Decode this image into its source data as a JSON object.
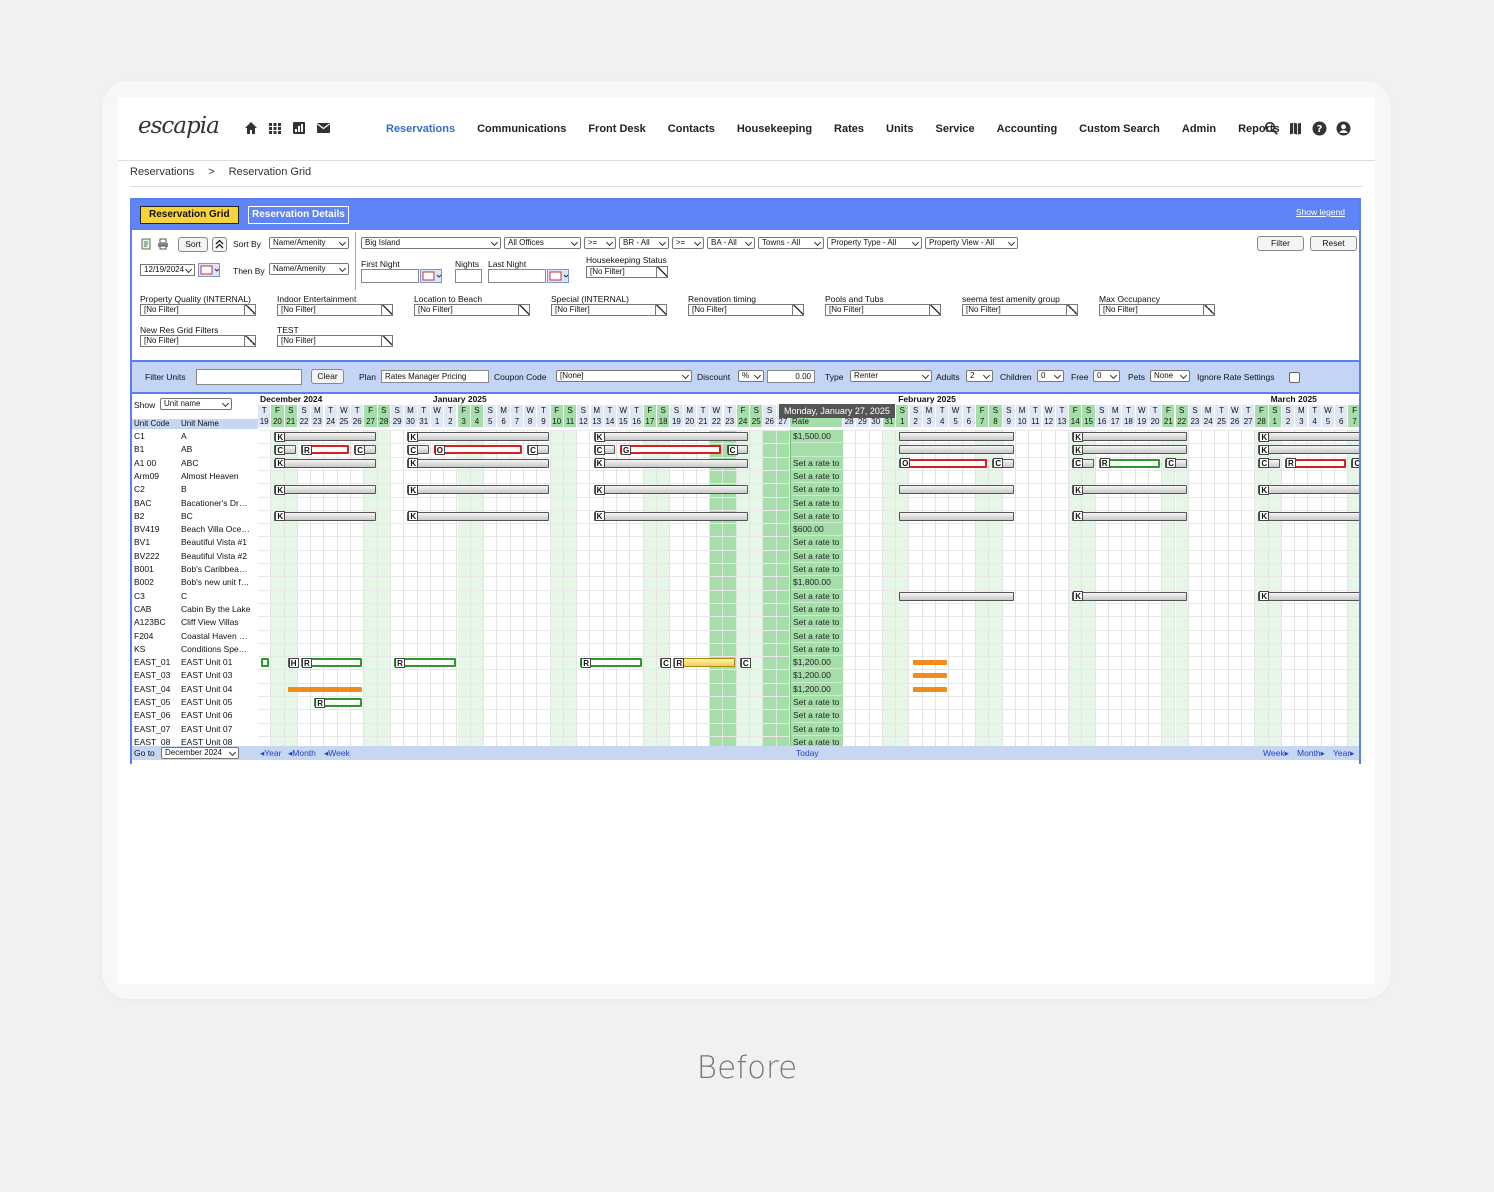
{
  "nav": {
    "logo": "escapia",
    "menu": [
      {
        "label": "Reservations",
        "active": true
      },
      {
        "label": "Communications"
      },
      {
        "label": "Front Desk"
      },
      {
        "label": "Contacts"
      },
      {
        "label": "Housekeeping"
      },
      {
        "label": "Rates"
      },
      {
        "label": "Units"
      },
      {
        "label": "Service"
      },
      {
        "label": "Accounting"
      },
      {
        "label": "Custom Search"
      },
      {
        "label": "Admin"
      },
      {
        "label": "Reports"
      }
    ],
    "quick_icons": [
      "home-icon",
      "grid-icon",
      "chart-icon",
      "mail-icon"
    ],
    "right_icons": [
      "search-icon",
      "map-icon",
      "help-icon",
      "user-icon"
    ]
  },
  "breadcrumb": {
    "root": "Reservations",
    "separator": ">",
    "current": "Reservation Grid"
  },
  "tabs": {
    "active": "Reservation Grid",
    "other": "Reservation Details",
    "legend": "Show legend"
  },
  "filters": {
    "sort_button": "Sort",
    "sort_by_label": "Sort By",
    "sort_by": "Name/Amenity",
    "then_by_label": "Then By",
    "then_by": "Name/Amenity",
    "date": "12/19/2024",
    "location": "Big Island",
    "office": "All Offices",
    "br_op": ">=",
    "br": "BR - All",
    "ba_op": ">=",
    "ba": "BA - All",
    "towns": "Towns - All",
    "property_type": "Property Type - All",
    "property_view": "Property View - All",
    "filter_button": "Filter",
    "reset_button": "Reset",
    "first_night_label": "First Night",
    "nights_label": "Nights",
    "last_night_label": "Last Night",
    "housekeeping_label": "Housekeeping Status",
    "no_filter": "[No Filter]",
    "amenities": [
      "Property Quality (INTERNAL)",
      "Indoor Entertainment",
      "Location to Beach",
      "Special (INTERNAL)",
      "Renovation timing",
      "Pools and Tubs",
      "seema test amenity group",
      "Max Occupancy",
      "New Res Grid Filters",
      "TEST"
    ]
  },
  "ratebar": {
    "filter_units_label": "Filter Units",
    "clear_button": "Clear",
    "plan_label": "Plan",
    "plan": "Rates Manager Pricing",
    "coupon_label": "Coupon Code",
    "coupon": "[None]",
    "discount_label": "Discount",
    "discount_type": "%",
    "discount_value": "0.00",
    "type_label": "Type",
    "type": "Renter",
    "adults_label": "Adults",
    "adults": "2",
    "children_label": "Children",
    "children": "0",
    "free_label": "Free",
    "free": "0",
    "pets_label": "Pets",
    "pets": "None",
    "ignore_label": "Ignore Rate Settings"
  },
  "grid": {
    "show_label": "Show",
    "show_value": "Unit name",
    "col_code": "Unit Code",
    "col_name": "Unit Name",
    "rate_header": "Rate",
    "tooltip": "Monday, January 27, 2025",
    "months": [
      {
        "label": "December 2024",
        "start": 0
      },
      {
        "label": "January 2025",
        "start": 13
      },
      {
        "label": "February 2025",
        "start": 44
      },
      {
        "label": "March 2025",
        "start": 72
      }
    ],
    "units": [
      {
        "code": "C1",
        "name": "A",
        "rate": "$1,500.00"
      },
      {
        "code": "B1",
        "name": "AB",
        "rate": ""
      },
      {
        "code": "A1 00",
        "name": "ABC",
        "rate": "Set a rate to"
      },
      {
        "code": "Arm09",
        "name": "Almost Heaven",
        "rate": "Set a rate to"
      },
      {
        "code": "C2",
        "name": "B",
        "rate": "Set a rate to"
      },
      {
        "code": "BAC",
        "name": "Bacationer's Dr…",
        "rate": "Set a rate to"
      },
      {
        "code": "B2",
        "name": "BC",
        "rate": "Set a rate to"
      },
      {
        "code": "BV419",
        "name": "Beach Villa Oce…",
        "rate": "$600.00"
      },
      {
        "code": "BV1",
        "name": "Beautiful Vista #1",
        "rate": "Set a rate to"
      },
      {
        "code": "BV222",
        "name": "Beautiful Vista #2",
        "rate": "Set a rate to"
      },
      {
        "code": "B001",
        "name": "Bob's Caribbea…",
        "rate": "Set a rate to"
      },
      {
        "code": "B002",
        "name": "Bob's new unit f…",
        "rate": "$1,800.00"
      },
      {
        "code": "C3",
        "name": "C",
        "rate": "Set a rate to"
      },
      {
        "code": "CAB",
        "name": "Cabin By the Lake",
        "rate": "Set a rate to"
      },
      {
        "code": "A123BC",
        "name": "Cliff View Villas",
        "rate": "Set a rate to"
      },
      {
        "code": "F204",
        "name": "Coastal Haven …",
        "rate": "Set a rate to"
      },
      {
        "code": "KS",
        "name": "Conditions Spe…",
        "rate": "Set a rate to"
      },
      {
        "code": "EAST_01",
        "name": "EAST Unit 01",
        "rate": "$1,200.00"
      },
      {
        "code": "EAST_03",
        "name": "EAST Unit 03",
        "rate": "$1,200.00"
      },
      {
        "code": "EAST_04",
        "name": "EAST Unit 04",
        "rate": "$1,200.00"
      },
      {
        "code": "EAST_05",
        "name": "EAST Unit 05",
        "rate": "Set a rate to"
      },
      {
        "code": "EAST_06",
        "name": "EAST Unit 06",
        "rate": "Set a rate to"
      },
      {
        "code": "EAST_07",
        "name": "EAST Unit 07",
        "rate": "Set a rate to"
      },
      {
        "code": "EAST_08",
        "name": "EAST Unit 08",
        "rate": "Set a rate to"
      }
    ],
    "bookings": [
      {
        "row": 0,
        "start": 1,
        "end": 9,
        "style": "gray",
        "letters": [
          "K"
        ]
      },
      {
        "row": 0,
        "start": 11,
        "end": 22,
        "style": "gray",
        "letters": [
          "K"
        ]
      },
      {
        "row": 0,
        "start": 25,
        "end": 37,
        "style": "gray",
        "letters": [
          "K"
        ]
      },
      {
        "row": 0,
        "start": 44,
        "end": 53,
        "style": "gray",
        "letters": []
      },
      {
        "row": 0,
        "start": 57,
        "end": 66,
        "style": "gray",
        "letters": [
          "K"
        ]
      },
      {
        "row": 0,
        "start": 71,
        "end": 80,
        "style": "gray",
        "letters": [
          "K"
        ]
      },
      {
        "row": 1,
        "start": 1,
        "end": 3,
        "style": "gray",
        "letters": [
          "C"
        ]
      },
      {
        "row": 1,
        "start": 3,
        "end": 7,
        "style": "red",
        "letters": [
          "R"
        ]
      },
      {
        "row": 1,
        "start": 7,
        "end": 9,
        "style": "gray",
        "letters": [
          "C"
        ]
      },
      {
        "row": 1,
        "start": 11,
        "end": 13,
        "style": "gray",
        "letters": [
          "C"
        ]
      },
      {
        "row": 1,
        "start": 13,
        "end": 20,
        "style": "red",
        "letters": [
          "O"
        ]
      },
      {
        "row": 1,
        "start": 20,
        "end": 22,
        "style": "gray",
        "letters": [
          "C"
        ]
      },
      {
        "row": 1,
        "start": 25,
        "end": 27,
        "style": "gray",
        "letters": [
          "C"
        ]
      },
      {
        "row": 1,
        "start": 27,
        "end": 35,
        "style": "red",
        "letters": [
          "G"
        ]
      },
      {
        "row": 1,
        "start": 35,
        "end": 37,
        "style": "gray",
        "letters": [
          "C"
        ]
      },
      {
        "row": 1,
        "start": 44,
        "end": 53,
        "style": "gray",
        "letters": []
      },
      {
        "row": 1,
        "start": 57,
        "end": 66,
        "style": "gray",
        "letters": [
          "K"
        ]
      },
      {
        "row": 1,
        "start": 71,
        "end": 80,
        "style": "gray",
        "letters": [
          "K"
        ]
      },
      {
        "row": 2,
        "start": 1,
        "end": 9,
        "style": "gray",
        "letters": [
          "K"
        ]
      },
      {
        "row": 2,
        "start": 11,
        "end": 22,
        "style": "gray",
        "letters": [
          "K"
        ]
      },
      {
        "row": 2,
        "start": 25,
        "end": 37,
        "style": "gray",
        "letters": [
          "K"
        ]
      },
      {
        "row": 2,
        "start": 44,
        "end": 51,
        "style": "red",
        "letters": [
          "O"
        ]
      },
      {
        "row": 2,
        "start": 51,
        "end": 53,
        "style": "gray",
        "letters": [
          "C"
        ]
      },
      {
        "row": 2,
        "start": 57,
        "end": 59,
        "style": "gray",
        "letters": [
          "C"
        ]
      },
      {
        "row": 2,
        "start": 59,
        "end": 64,
        "style": "grn",
        "letters": [
          "R"
        ]
      },
      {
        "row": 2,
        "start": 64,
        "end": 66,
        "style": "gray",
        "letters": [
          "C"
        ]
      },
      {
        "row": 2,
        "start": 71,
        "end": 73,
        "style": "gray",
        "letters": [
          "C"
        ]
      },
      {
        "row": 2,
        "start": 73,
        "end": 78,
        "style": "red",
        "letters": [
          "R"
        ]
      },
      {
        "row": 2,
        "start": 78,
        "end": 80,
        "style": "gray",
        "letters": [
          "C"
        ]
      },
      {
        "row": 4,
        "start": 1,
        "end": 9,
        "style": "gray",
        "letters": [
          "K"
        ]
      },
      {
        "row": 4,
        "start": 11,
        "end": 22,
        "style": "gray",
        "letters": [
          "K"
        ]
      },
      {
        "row": 4,
        "start": 25,
        "end": 37,
        "style": "gray",
        "letters": [
          "K"
        ]
      },
      {
        "row": 4,
        "start": 44,
        "end": 53,
        "style": "gray",
        "letters": []
      },
      {
        "row": 4,
        "start": 57,
        "end": 66,
        "style": "gray",
        "letters": [
          "K"
        ]
      },
      {
        "row": 4,
        "start": 71,
        "end": 80,
        "style": "gray",
        "letters": [
          "K"
        ]
      },
      {
        "row": 6,
        "start": 1,
        "end": 9,
        "style": "gray",
        "letters": [
          "K"
        ]
      },
      {
        "row": 6,
        "start": 11,
        "end": 22,
        "style": "gray",
        "letters": [
          "K"
        ]
      },
      {
        "row": 6,
        "start": 25,
        "end": 37,
        "style": "gray",
        "letters": [
          "K"
        ]
      },
      {
        "row": 6,
        "start": 44,
        "end": 53,
        "style": "gray",
        "letters": []
      },
      {
        "row": 6,
        "start": 57,
        "end": 66,
        "style": "gray",
        "letters": [
          "K"
        ]
      },
      {
        "row": 6,
        "start": 71,
        "end": 80,
        "style": "gray",
        "letters": [
          "K"
        ]
      },
      {
        "row": 12,
        "start": 44,
        "end": 53,
        "style": "gray",
        "letters": []
      },
      {
        "row": 12,
        "start": 57,
        "end": 66,
        "style": "gray",
        "letters": [
          "K"
        ]
      },
      {
        "row": 12,
        "start": 71,
        "end": 80,
        "style": "gray",
        "letters": [
          "K"
        ]
      },
      {
        "row": 17,
        "start": 0,
        "end": 1,
        "style": "grn",
        "letters": []
      },
      {
        "row": 17,
        "start": 2,
        "end": 3,
        "style": "gray",
        "letters": [
          "H"
        ]
      },
      {
        "row": 17,
        "start": 3,
        "end": 8,
        "style": "grn",
        "letters": [
          "R"
        ]
      },
      {
        "row": 17,
        "start": 10,
        "end": 15,
        "style": "grn",
        "letters": [
          "R"
        ]
      },
      {
        "row": 17,
        "start": 24,
        "end": 29,
        "style": "grn",
        "letters": [
          "R"
        ]
      },
      {
        "row": 17,
        "start": 30,
        "end": 31,
        "style": "gray",
        "letters": [
          "C"
        ]
      },
      {
        "row": 17,
        "start": 31,
        "end": 36,
        "style": "yel",
        "letters": [
          "R"
        ]
      },
      {
        "row": 17,
        "start": 36,
        "end": 37,
        "style": "gray",
        "letters": [
          "C"
        ]
      },
      {
        "row": 17,
        "start": 45,
        "end": 48,
        "style": "org",
        "letters": []
      },
      {
        "row": 18,
        "start": 45,
        "end": 48,
        "style": "org",
        "letters": []
      },
      {
        "row": 19,
        "start": 2,
        "end": 8,
        "style": "org",
        "letters": []
      },
      {
        "row": 19,
        "start": 45,
        "end": 48,
        "style": "org",
        "letters": []
      },
      {
        "row": 20,
        "start": 4,
        "end": 8,
        "style": "grn",
        "letters": [
          "R"
        ]
      }
    ]
  },
  "footer": {
    "goto_label": "Go to",
    "goto_value": "December 2024",
    "prev_year": "◂Year",
    "prev_month": "◂Month",
    "prev_week": "◂Week",
    "today": "Today",
    "next_week": "Week▸",
    "next_month": "Month▸",
    "next_year": "Year▸"
  },
  "caption": "Before"
}
